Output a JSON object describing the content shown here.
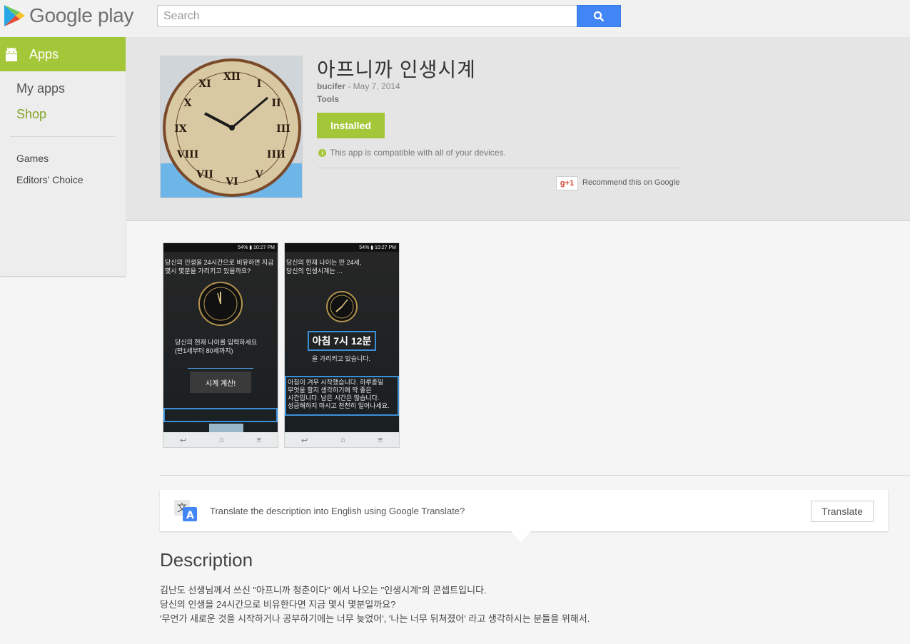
{
  "header": {
    "logo_text": "Google play",
    "search_placeholder": "Search"
  },
  "sidebar": {
    "section": "Apps",
    "links": [
      "My apps",
      "Shop"
    ],
    "sublinks": [
      "Games",
      "Editors' Choice"
    ]
  },
  "app": {
    "title": "아프니까 인생시계",
    "developer": "bucifer",
    "date": " - May 7, 2014",
    "category": "Tools",
    "install_label": "Installed",
    "compat_text": "This app is compatible with all of your devices.",
    "gplus_label": "g+1",
    "recommend_text": "Recommend this on Google"
  },
  "screenshots": [
    {
      "status_text": "54% ▮ 10:27 PM",
      "line1": "당신의 인생을 24시간으로 비유하면 지금",
      "line2": "몇시 몇분을 가리키고 있을까요?",
      "prompt1": "당신의 현재 나이를 입력하세요",
      "prompt2": "(만1세부터 80세까지)",
      "button": "시계 계산!"
    },
    {
      "status_text": "54% ▮ 10:27 PM",
      "line1": "당신의 현재 나이는 만 24세,",
      "line2": "당신의 인생시계는 ...",
      "time": "아침 7시 12분",
      "pointing": "을 가리키고 있습니다.",
      "msg1": "아침이 겨우 시작했습니다. 하루종일",
      "msg2": "무엇을 할지 생각하기에 딱 좋은",
      "msg3": "시간입니다. 남은 시간은 많습니다.",
      "msg4": "성급해하지 마시고 천천히 일어나세요."
    }
  ],
  "translate": {
    "text": "Translate the description into English using Google Translate?",
    "button": "Translate"
  },
  "description": {
    "title": "Description",
    "lines": [
      "김난도 선생님께서 쓰신 \"아프니까 청춘이다\" 에서 나오는 \"인생시계\"의 콘셉트입니다.",
      "당신의 인생을 24시간으로 비유한다면 지금 몇시 몇분일까요?",
      "'무언가 새로운 것을 시작하거나 공부하기에는 너무 늦었어', '나는 너무 뒤쳐졌어' 라고 생각하시는 분들을 위해서."
    ]
  },
  "colors": {
    "accent_green": "#a4c639",
    "search_blue": "#4285f4"
  }
}
